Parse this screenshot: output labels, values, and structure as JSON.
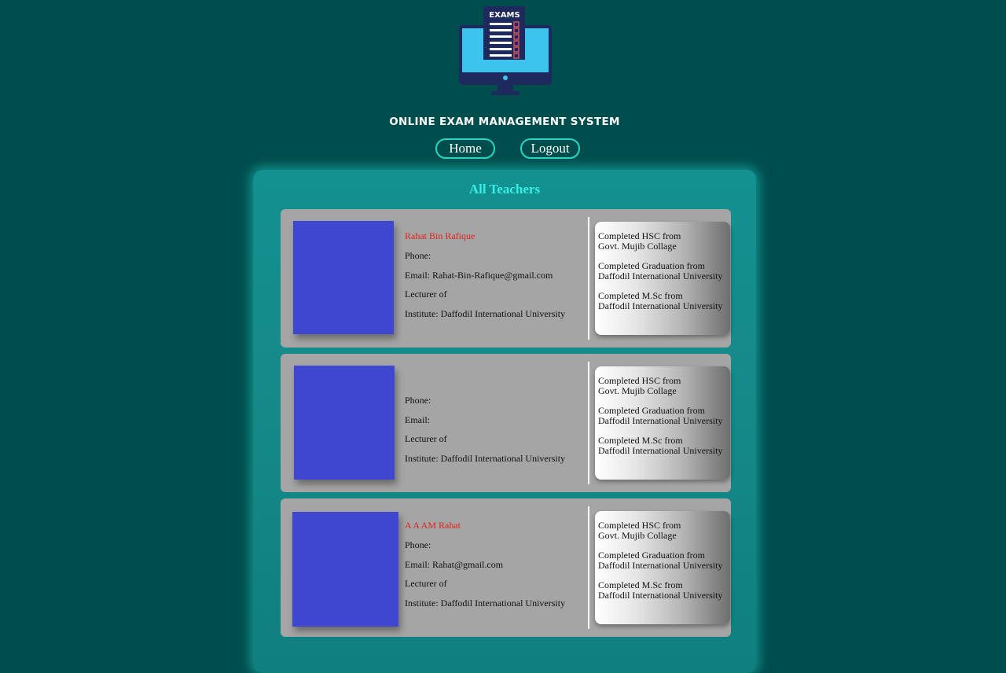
{
  "header": {
    "logo_text": "EXAMS",
    "site_title": "ONLINE EXAM MANAGEMENT SYSTEM",
    "nav": {
      "home_label": "Home",
      "logout_label": "Logout"
    }
  },
  "panel": {
    "title": "All Teachers"
  },
  "teachers": [
    {
      "name": "Rahat Bin Rafique",
      "phone": "Phone:",
      "email": "Email: Rahat-Bin-Rafique@gmail.com",
      "position": "Lecturer of",
      "institute": "Institute: Daffodil International University",
      "education": [
        {
          "title": "Completed HSC from",
          "place": "Govt. Mujib Collage"
        },
        {
          "title": "Completed Graduation from",
          "place": "Daffodil International University"
        },
        {
          "title": "Completed M.Sc from",
          "place": "Daffodil International University"
        }
      ]
    },
    {
      "name": "",
      "phone": "Phone:",
      "email": "Email:",
      "position": "Lecturer of",
      "institute": "Institute: Daffodil International University",
      "education": [
        {
          "title": "Completed HSC from",
          "place": "Govt. Mujib Collage"
        },
        {
          "title": "Completed Graduation from",
          "place": "Daffodil International University"
        },
        {
          "title": "Completed M.Sc from",
          "place": "Daffodil International University"
        }
      ]
    },
    {
      "name": "A A AM Rahat",
      "phone": "Phone:",
      "email": "Email: Rahat@gmail.com",
      "position": "Lecturer of",
      "institute": "Institute: Daffodil International University",
      "education": [
        {
          "title": "Completed HSC from",
          "place": "Govt. Mujib Collage"
        },
        {
          "title": "Completed Graduation from",
          "place": "Daffodil International University"
        },
        {
          "title": "Completed M.Sc from",
          "place": "Daffodil International University"
        }
      ]
    }
  ],
  "colors": {
    "background": "#004d4d",
    "panel": "#168a8a",
    "accent": "#35f0e3",
    "button_border": "#28d6c2",
    "card": "#a5a5a5",
    "photo_placeholder": "#3f47d0",
    "name_text": "#e0221c"
  },
  "icons": {
    "logo": "exam-monitor-icon"
  }
}
